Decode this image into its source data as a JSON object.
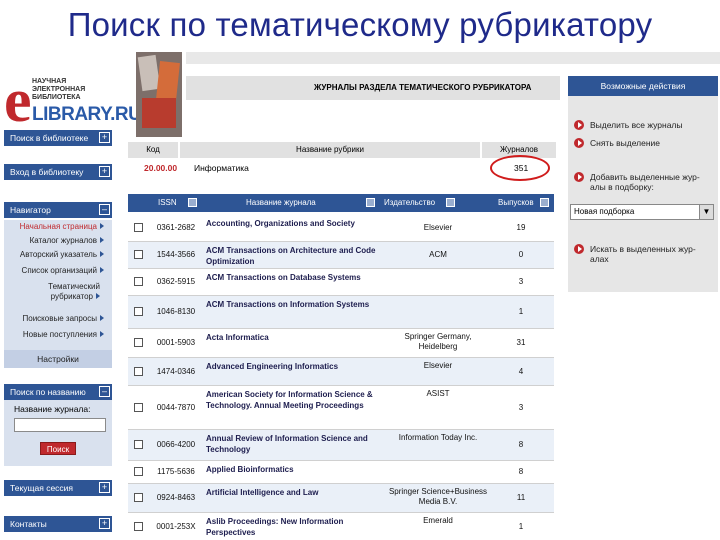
{
  "slide_title": "Поиск по тематическому рубрикатору",
  "logo": {
    "top_text": "НАУЧНАЯ ЭЛЕКТРОННАЯ БИБЛИОТЕКА",
    "letter": "e",
    "main_text": "LIBRARY.RU"
  },
  "header": {
    "title": "ЖУРНАЛЫ РАЗДЕЛА ТЕМАТИЧЕСКОГО РУБРИКАТОРА"
  },
  "sidebar": {
    "login": "Поиск в библиотеке",
    "enter": "Вход в библиотеку",
    "navigator": "Навигатор",
    "items": [
      "Начальная страница",
      "Каталог журналов",
      "Авторский указатель",
      "Список организаций",
      "Тематический рубрикатор",
      "Поисковые запросы",
      "Новые поступления"
    ],
    "settings": "Настройки",
    "search_title": "Поиск по названию",
    "search_label": "Название журнала:",
    "search_button": "Поиск",
    "current_session": "Текущая сессия",
    "contacts": "Контакты",
    "plus": "+",
    "minus": "–"
  },
  "rubric_table": {
    "headers": {
      "code": "Код",
      "name": "Название рубрики",
      "journals": "Журналов"
    },
    "row": {
      "code": "20.00.00",
      "name": "Информатика",
      "count": "351"
    }
  },
  "journal_table": {
    "headers": {
      "issn": "ISSN",
      "name": "Название журнала",
      "publisher": "Издательство",
      "issues": "Выпусков"
    },
    "rows": [
      {
        "issn": "0361-2682",
        "name": "Accounting, Organizations and Society",
        "publisher": "Elsevier",
        "issues": "19"
      },
      {
        "issn": "1544-3566",
        "name": "ACM Transactions on Architecture and Code Optimization",
        "publisher": "ACM",
        "issues": "0"
      },
      {
        "issn": "0362-5915",
        "name": "ACM Transactions on Database Systems",
        "publisher": "",
        "issues": "3"
      },
      {
        "issn": "1046-8130",
        "name": "ACM Transactions on Information Systems",
        "publisher": "",
        "issues": "1"
      },
      {
        "issn": "0001-5903",
        "name": "Acta Informatica",
        "publisher": "Springer Germany, Heidelberg",
        "issues": "31"
      },
      {
        "issn": "1474-0346",
        "name": "Advanced Engineering Informatics",
        "publisher": "Elsevier",
        "issues": "4"
      },
      {
        "issn": "0044-7870",
        "name": "American Society for Information Science & Technology. Annual Meeting Proceedings",
        "publisher": "ASIST",
        "issues": "3"
      },
      {
        "issn": "0066-4200",
        "name": "Annual Review of Information Science and Technology",
        "publisher": "Information Today Inc.",
        "issues": "8"
      },
      {
        "issn": "1175-5636",
        "name": "Applied Bioinformatics",
        "publisher": "",
        "issues": "8"
      },
      {
        "issn": "0924-8463",
        "name": "Artificial Intelligence and Law",
        "publisher": "Springer Science+Business Media B.V.",
        "issues": "11"
      },
      {
        "issn": "0001-253X",
        "name": "Aslib Proceedings: New Information Perspectives",
        "publisher": "Emerald",
        "issues": "1"
      }
    ]
  },
  "actions": {
    "title": "Возможные действия",
    "items": [
      "Выделить все журналы",
      "Снять выделение",
      "Добавить выделенные жур-алы в подборку:",
      "Искать в выделенных жур-алах"
    ],
    "select_value": "Новая подборка"
  }
}
